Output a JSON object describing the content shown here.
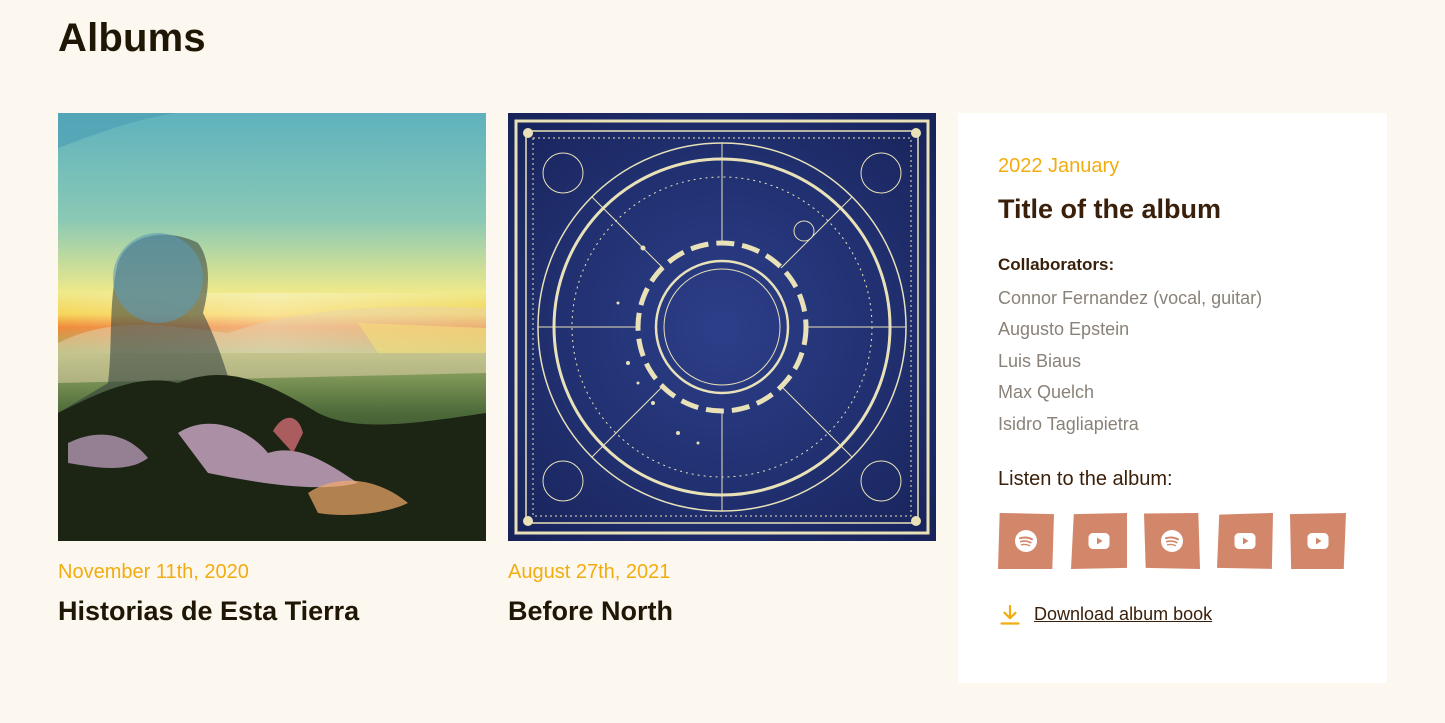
{
  "page": {
    "title": "Albums"
  },
  "albums": [
    {
      "date": "November 11th, 2020",
      "title": "Historias de Esta Tierra",
      "cover": "landscape-with-silhouette-cover"
    },
    {
      "date": "August 27th, 2021",
      "title": "Before North",
      "cover": "moon-celestial-map-cover"
    }
  ],
  "detail": {
    "date": "2022 January",
    "title": "Title of the album",
    "collaborators_heading": "Collaborators:",
    "collaborators": [
      "Connor Fernandez (vocal, guitar)",
      "Augusto Epstein",
      "Luis Biaus",
      "Max Quelch",
      "Isidro Tagliapietra"
    ],
    "listen_label": "Listen to the album:",
    "platforms": [
      "spotify-icon",
      "youtube-icon",
      "spotify-icon",
      "youtube-icon",
      "youtube-icon"
    ],
    "download_label": "Download album book"
  },
  "colors": {
    "background": "#fdf8ef",
    "accent": "#f2ac10",
    "button": "#d3876a",
    "heading": "#1f1605"
  }
}
